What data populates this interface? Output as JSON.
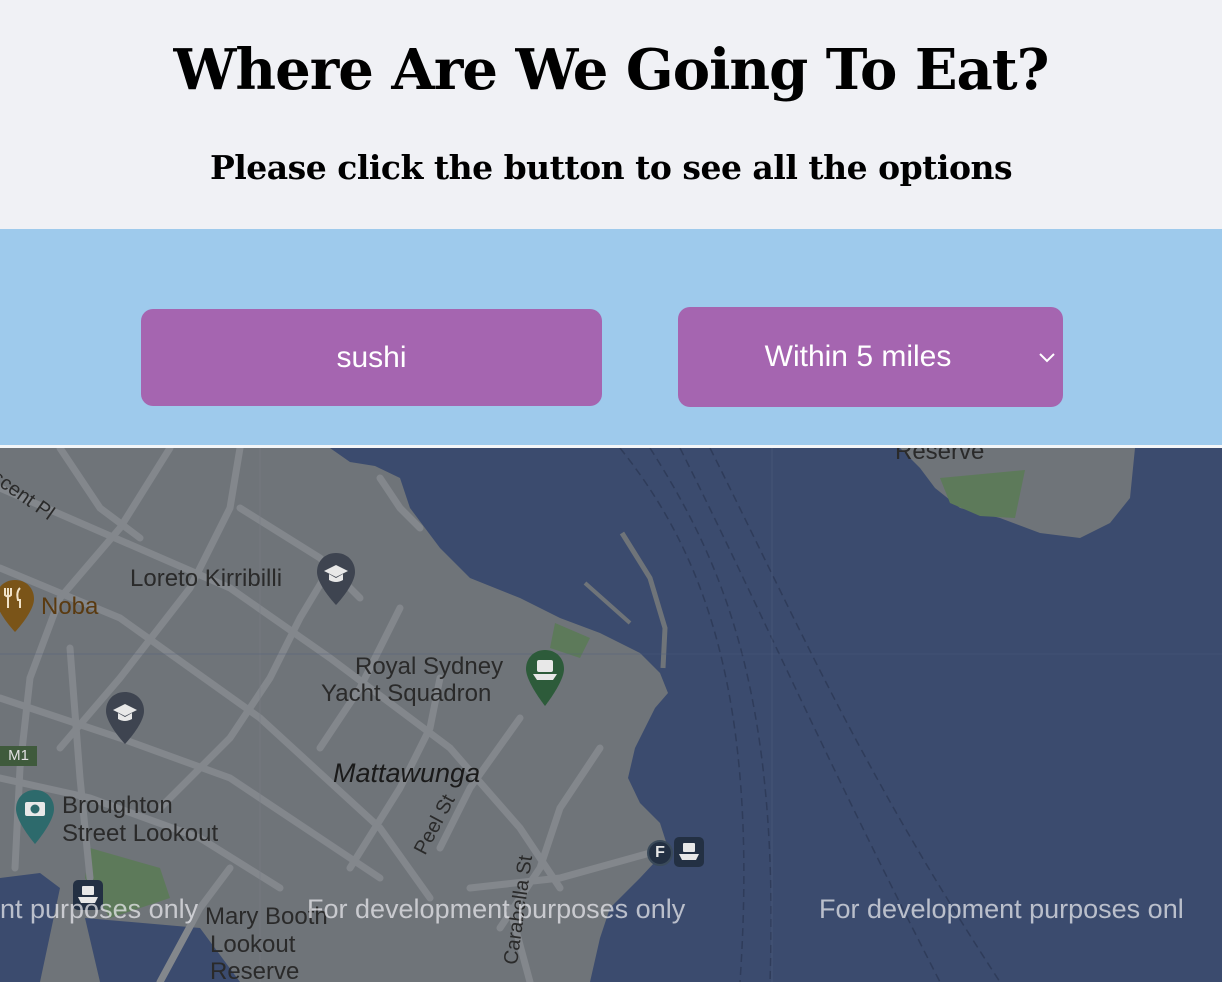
{
  "header": {
    "title": "Where Are We Going To Eat?",
    "subtitle": "Please click the button to see all the options"
  },
  "controls": {
    "search_value": "sushi",
    "distance_selected": "Within 5 miles"
  },
  "map": {
    "labels": {
      "loreto": "Loreto Kirribilli",
      "noba": "Noba",
      "royal_sydney_1": "Royal Sydney",
      "royal_sydney_2": "Yacht Squadron",
      "mattawunga": "Mattawunga",
      "broughton_1": "Broughton",
      "broughton_2": "Street Lookout",
      "mary_booth_1": "Mary Booth",
      "mary_booth_2": "Lookout",
      "mary_booth_3": "Reserve",
      "reserve_top": "Reserve",
      "crescent_pl": "scent Pl",
      "peel_st": "Peel St",
      "carabella_st": "Carabella St",
      "m1_badge": "M1",
      "ferry_f": "F"
    },
    "watermarks": [
      "nt purposes only",
      "For development purposes only",
      "For development purposes onl"
    ]
  },
  "colors": {
    "header_bg": "#f0f1f5",
    "controls_bg": "#9ecaec",
    "button_bg": "#a565b0",
    "water": "#3b4b6e",
    "land": "#6f7479"
  }
}
